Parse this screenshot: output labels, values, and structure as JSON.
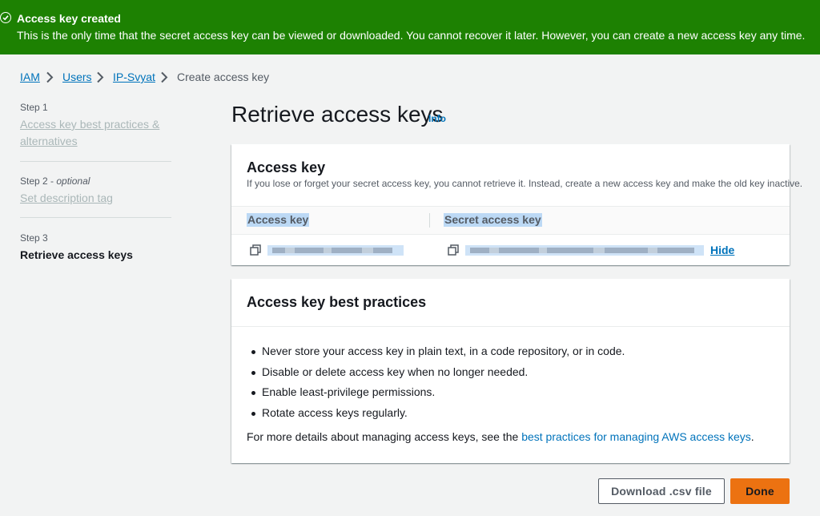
{
  "banner": {
    "title": "Access key created",
    "message": "This is the only time that the secret access key can be viewed or downloaded. You cannot recover it later. However, you can create a new access key any time.",
    "icon": "check-circle-icon",
    "color": "#1d8102"
  },
  "breadcrumb": [
    "IAM",
    "Users",
    "IP-Svyat",
    "Create access key"
  ],
  "steps": [
    {
      "label": "Step 1",
      "title": "Access key best practices & alternatives"
    },
    {
      "label": "Step 2",
      "optional": "optional",
      "title": "Set description tag"
    },
    {
      "label": "Step 3",
      "title": "Retrieve access keys"
    }
  ],
  "page": {
    "title": "Retrieve access keys",
    "info": "Info"
  },
  "access_key_panel": {
    "title": "Access key",
    "description": "If you lose or forget your secret access key, you cannot retrieve it. Instead, create a new access key and make the old key inactive.",
    "columns": [
      "Access key",
      "Secret access key"
    ],
    "hide_label": "Hide",
    "copy_icon": "copy-icon"
  },
  "best_practices": {
    "title": "Access key best practices",
    "items": [
      "Never store your access key in plain text, in a code repository, or in code.",
      "Disable or delete access key when no longer needed.",
      "Enable least-privilege permissions.",
      "Rotate access keys regularly."
    ],
    "more_prefix": "For more details about managing access keys, see the ",
    "more_link": "best practices for managing AWS access keys",
    "more_suffix": "."
  },
  "buttons": {
    "download": "Download .csv file",
    "done": "Done"
  },
  "colors": {
    "link": "#0073bb",
    "primary": "#ec7211",
    "background": "#f2f3f3"
  }
}
